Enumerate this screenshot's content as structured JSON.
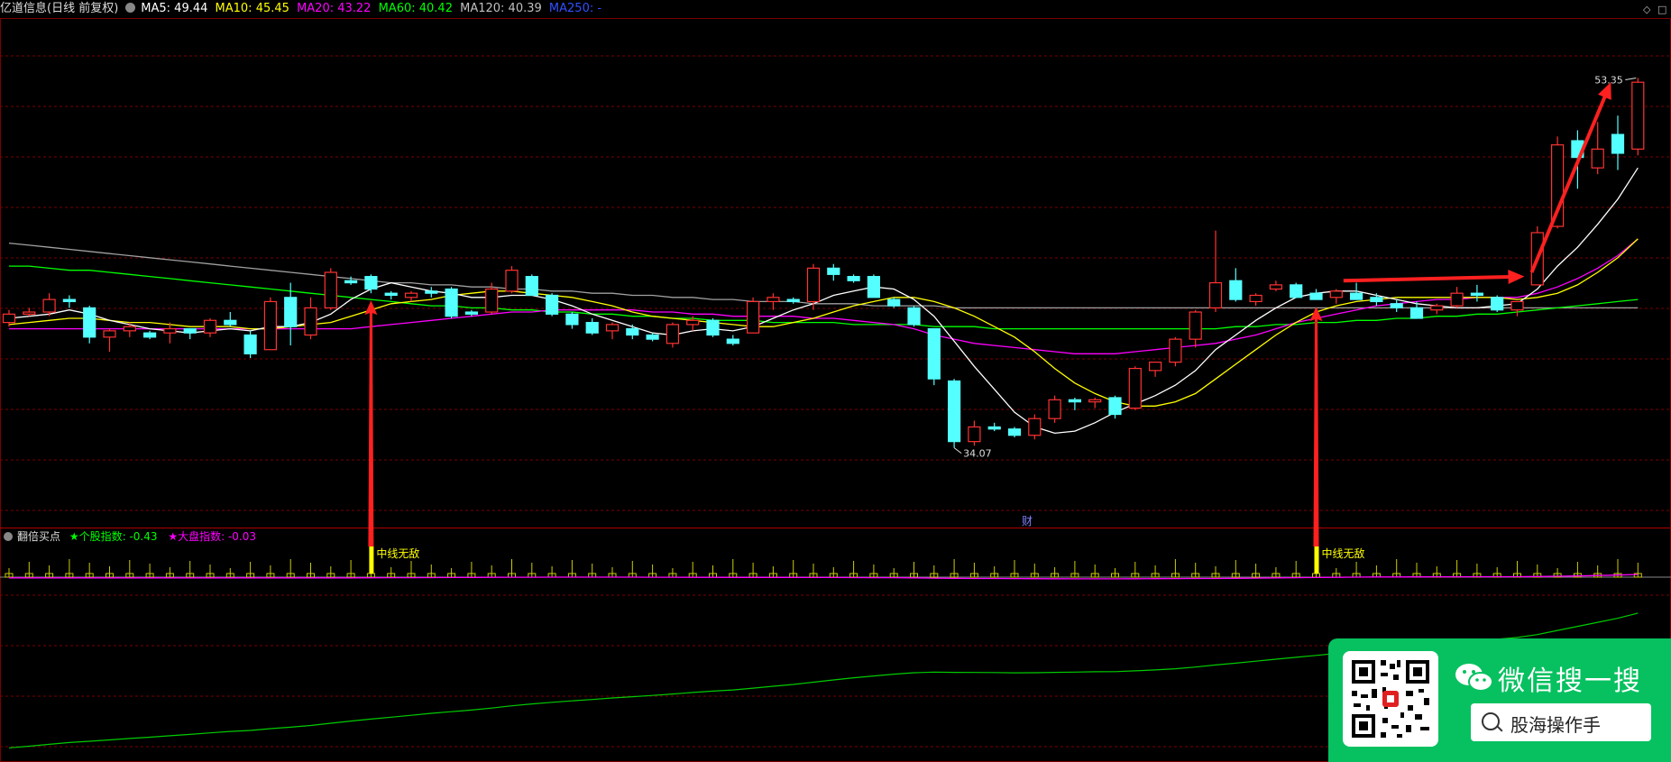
{
  "header": {
    "stock": "亿道信息(日线 前复权)",
    "ma5": "MA5: 49.44",
    "ma10": "MA10: 45.45",
    "ma20": "MA20: 43.22",
    "ma60": "MA60: 40.42",
    "ma120": "MA120: 40.39",
    "ma250": "MA250: -"
  },
  "indicator": {
    "name": "翻倍买点",
    "stock_index": "★个股指数: -0.43",
    "market_index": "★大盘指数: -0.03"
  },
  "annotations": {
    "high_label": "53.35",
    "low_label": "34.07",
    "cai": "财",
    "signal_label": "中线无敌"
  },
  "wechat": {
    "title": "微信搜一搜",
    "search_text": "股海操作手"
  },
  "colors": {
    "up": "#ff3232",
    "down": "#54ffff",
    "ma5": "#ffffff",
    "ma10": "#ffff00",
    "ma20": "#ff00ff",
    "ma60": "#00ff00",
    "ma120": "#a0a0a0",
    "arrow": "#ff2020",
    "signal": "#ffff00",
    "grid": "#7a0000"
  },
  "chart_data": {
    "type": "candlestick",
    "ylim": [
      32,
      56
    ],
    "candles": [
      [
        41.6,
        42.2,
        41.4,
        42.0
      ],
      [
        42.0,
        42.3,
        41.9,
        42.1
      ],
      [
        42.1,
        43.0,
        41.9,
        42.7
      ],
      [
        42.7,
        42.9,
        42.3,
        42.6
      ],
      [
        42.3,
        42.4,
        40.6,
        40.9
      ],
      [
        40.9,
        41.3,
        40.2,
        41.2
      ],
      [
        41.2,
        41.6,
        40.9,
        41.4
      ],
      [
        41.1,
        41.2,
        40.8,
        40.9
      ],
      [
        41.1,
        41.6,
        40.6,
        41.3
      ],
      [
        41.3,
        41.3,
        40.8,
        41.1
      ],
      [
        41.1,
        41.8,
        40.9,
        41.7
      ],
      [
        41.7,
        42.1,
        41.4,
        41.5
      ],
      [
        41.0,
        41.2,
        39.9,
        40.1
      ],
      [
        40.3,
        42.8,
        40.3,
        42.6
      ],
      [
        42.8,
        43.5,
        40.5,
        41.4
      ],
      [
        41.0,
        42.8,
        40.8,
        42.3
      ],
      [
        42.3,
        44.2,
        42.2,
        44.0
      ],
      [
        43.6,
        43.8,
        43.4,
        43.5
      ],
      [
        43.8,
        43.9,
        43.0,
        43.2
      ],
      [
        43.0,
        43.1,
        42.7,
        42.9
      ],
      [
        42.8,
        43.1,
        42.6,
        43.0
      ],
      [
        43.1,
        43.3,
        42.8,
        43.0
      ],
      [
        43.2,
        43.3,
        41.8,
        41.9
      ],
      [
        42.1,
        42.2,
        41.9,
        42.0
      ],
      [
        42.1,
        43.5,
        42.0,
        43.2
      ],
      [
        43.1,
        44.3,
        43.0,
        44.1
      ],
      [
        43.8,
        43.9,
        42.9,
        42.9
      ],
      [
        42.9,
        43.0,
        41.9,
        42.0
      ],
      [
        42.0,
        42.1,
        41.3,
        41.5
      ],
      [
        41.6,
        41.8,
        41.0,
        41.1
      ],
      [
        41.2,
        41.6,
        40.8,
        41.5
      ],
      [
        41.3,
        41.5,
        40.8,
        41.0
      ],
      [
        41.0,
        41.1,
        40.7,
        40.8
      ],
      [
        40.6,
        41.6,
        40.4,
        41.5
      ],
      [
        41.5,
        41.9,
        41.2,
        41.7
      ],
      [
        41.7,
        41.8,
        40.9,
        41.0
      ],
      [
        40.8,
        41.0,
        40.5,
        40.6
      ],
      [
        41.1,
        42.8,
        41.1,
        42.6
      ],
      [
        42.6,
        43.0,
        42.2,
        42.8
      ],
      [
        42.7,
        42.8,
        42.5,
        42.6
      ],
      [
        42.6,
        44.4,
        42.2,
        44.2
      ],
      [
        44.2,
        44.4,
        43.6,
        43.9
      ],
      [
        43.8,
        43.9,
        43.5,
        43.6
      ],
      [
        43.8,
        43.9,
        42.8,
        42.8
      ],
      [
        42.7,
        42.8,
        42.3,
        42.4
      ],
      [
        42.3,
        42.4,
        41.4,
        41.5
      ],
      [
        41.3,
        41.3,
        38.6,
        38.9
      ],
      [
        38.8,
        38.9,
        35.6,
        35.9
      ],
      [
        35.9,
        36.9,
        35.7,
        36.6
      ],
      [
        36.6,
        36.8,
        36.4,
        36.5
      ],
      [
        36.5,
        36.6,
        36.1,
        36.2
      ],
      [
        36.2,
        37.2,
        36.0,
        37.0
      ],
      [
        37.0,
        38.1,
        36.8,
        37.9
      ],
      [
        37.9,
        38.0,
        37.4,
        37.8
      ],
      [
        37.8,
        38.0,
        37.5,
        37.9
      ],
      [
        38.0,
        38.1,
        37.0,
        37.2
      ],
      [
        37.5,
        39.5,
        37.4,
        39.4
      ],
      [
        39.3,
        39.7,
        39.0,
        39.7
      ],
      [
        39.7,
        40.9,
        39.5,
        40.8
      ],
      [
        40.8,
        42.2,
        40.4,
        42.1
      ],
      [
        42.3,
        46.0,
        42.1,
        43.5
      ],
      [
        43.6,
        44.2,
        42.6,
        42.7
      ],
      [
        42.6,
        43.0,
        42.4,
        42.9
      ],
      [
        43.2,
        43.6,
        43.1,
        43.4
      ],
      [
        43.4,
        43.5,
        42.8,
        42.8
      ],
      [
        43.0,
        43.2,
        42.7,
        42.7
      ],
      [
        42.8,
        43.2,
        42.5,
        43.1
      ],
      [
        43.0,
        43.5,
        42.8,
        42.7
      ],
      [
        42.8,
        43.0,
        42.4,
        42.6
      ],
      [
        42.5,
        42.7,
        42.1,
        42.3
      ],
      [
        42.3,
        42.6,
        41.8,
        41.8
      ],
      [
        42.2,
        42.5,
        42.0,
        42.4
      ],
      [
        42.4,
        43.3,
        42.3,
        43.0
      ],
      [
        43.0,
        43.4,
        42.6,
        42.9
      ],
      [
        42.8,
        42.9,
        42.1,
        42.2
      ],
      [
        42.2,
        42.6,
        41.9,
        42.6
      ],
      [
        43.4,
        46.2,
        43.4,
        45.9
      ],
      [
        46.2,
        50.5,
        46.1,
        50.1
      ],
      [
        50.3,
        50.8,
        48.0,
        49.5
      ],
      [
        49.0,
        51.2,
        48.7,
        49.9
      ],
      [
        50.6,
        51.5,
        48.9,
        49.7
      ],
      [
        49.9,
        53.3,
        49.6,
        53.1
      ]
    ],
    "ma5": [
      41.8,
      41.9,
      42.0,
      42.2,
      42.0,
      41.7,
      41.5,
      41.3,
      41.2,
      41.1,
      41.2,
      41.3,
      41.2,
      41.4,
      41.4,
      41.6,
      42.0,
      42.7,
      43.2,
      43.5,
      43.3,
      43.1,
      43.0,
      42.8,
      42.8,
      42.9,
      42.9,
      42.7,
      42.4,
      42.0,
      41.7,
      41.4,
      41.1,
      41.0,
      41.2,
      41.3,
      41.2,
      41.4,
      41.8,
      42.2,
      42.5,
      42.9,
      43.1,
      43.3,
      43.2,
      42.7,
      41.9,
      40.7,
      39.5,
      38.4,
      37.3,
      36.6,
      36.3,
      36.4,
      36.8,
      37.3,
      37.7,
      38.1,
      38.6,
      39.3,
      40.3,
      41.0,
      41.7,
      42.3,
      42.8,
      43.0,
      43.1,
      43.1,
      42.9,
      42.7,
      42.5,
      42.4,
      42.3,
      42.3,
      42.4,
      42.5,
      43.2,
      44.3,
      45.2,
      46.3,
      47.5,
      49.0
    ],
    "ma10": [
      41.5,
      41.6,
      41.7,
      41.8,
      41.8,
      41.7,
      41.6,
      41.6,
      41.5,
      41.4,
      41.4,
      41.4,
      41.3,
      41.3,
      41.4,
      41.5,
      41.6,
      41.9,
      42.2,
      42.5,
      42.6,
      42.7,
      42.9,
      43.0,
      43.1,
      43.1,
      43.0,
      42.9,
      42.8,
      42.6,
      42.4,
      42.1,
      41.9,
      41.8,
      41.7,
      41.6,
      41.5,
      41.4,
      41.4,
      41.6,
      41.8,
      42.1,
      42.4,
      42.6,
      42.8,
      42.8,
      42.6,
      42.3,
      41.9,
      41.4,
      40.9,
      40.2,
      39.4,
      38.7,
      38.2,
      37.8,
      37.6,
      37.6,
      37.8,
      38.2,
      38.9,
      39.6,
      40.3,
      41.0,
      41.6,
      42.1,
      42.4,
      42.6,
      42.7,
      42.8,
      42.8,
      42.8,
      42.8,
      42.8,
      42.8,
      42.7,
      42.8,
      43.0,
      43.4,
      44.0,
      44.7,
      45.6
    ],
    "ma20": [
      41.3,
      41.3,
      41.3,
      41.3,
      41.3,
      41.3,
      41.3,
      41.3,
      41.3,
      41.3,
      41.3,
      41.3,
      41.3,
      41.3,
      41.3,
      41.3,
      41.3,
      41.3,
      41.4,
      41.5,
      41.6,
      41.7,
      41.8,
      41.9,
      42.0,
      42.1,
      42.1,
      42.2,
      42.2,
      42.2,
      42.2,
      42.2,
      42.1,
      42.1,
      42.0,
      42.0,
      41.9,
      41.9,
      41.9,
      41.9,
      41.8,
      41.8,
      41.7,
      41.6,
      41.5,
      41.3,
      41.0,
      40.8,
      40.6,
      40.5,
      40.4,
      40.3,
      40.2,
      40.1,
      40.1,
      40.1,
      40.2,
      40.3,
      40.4,
      40.5,
      40.6,
      40.8,
      41.0,
      41.3,
      41.6,
      41.8,
      42.0,
      42.2,
      42.4,
      42.5,
      42.6,
      42.7,
      42.7,
      42.8,
      42.8,
      42.8,
      43.0,
      43.3,
      43.7,
      44.2,
      44.8,
      45.6
    ],
    "ma60": [
      44.3,
      44.3,
      44.2,
      44.1,
      44.1,
      44.0,
      43.9,
      43.8,
      43.7,
      43.6,
      43.5,
      43.4,
      43.3,
      43.2,
      43.1,
      43.0,
      42.9,
      42.8,
      42.7,
      42.6,
      42.5,
      42.4,
      42.4,
      42.3,
      42.3,
      42.2,
      42.2,
      42.1,
      42.1,
      42.0,
      42.0,
      41.9,
      41.9,
      41.8,
      41.8,
      41.7,
      41.7,
      41.7,
      41.6,
      41.6,
      41.6,
      41.6,
      41.5,
      41.5,
      41.5,
      41.5,
      41.4,
      41.4,
      41.4,
      41.3,
      41.3,
      41.3,
      41.3,
      41.3,
      41.3,
      41.3,
      41.3,
      41.3,
      41.3,
      41.3,
      41.3,
      41.4,
      41.4,
      41.5,
      41.5,
      41.6,
      41.6,
      41.7,
      41.7,
      41.8,
      41.8,
      41.9,
      41.9,
      42.0,
      42.0,
      42.1,
      42.2,
      42.3,
      42.4,
      42.5,
      42.6,
      42.7
    ],
    "ma120": [
      45.4,
      45.3,
      45.2,
      45.1,
      45.0,
      44.9,
      44.8,
      44.7,
      44.6,
      44.5,
      44.4,
      44.3,
      44.2,
      44.1,
      44.0,
      43.9,
      43.8,
      43.7,
      43.6,
      43.5,
      43.5,
      43.4,
      43.4,
      43.3,
      43.3,
      43.2,
      43.2,
      43.1,
      43.1,
      43.0,
      43.0,
      42.9,
      42.9,
      42.8,
      42.8,
      42.7,
      42.7,
      42.6,
      42.6,
      42.6,
      42.5,
      42.5,
      42.5,
      42.4,
      42.4,
      42.4,
      42.4,
      42.3,
      42.3,
      42.3,
      42.3,
      42.3,
      42.3,
      42.3,
      42.3,
      42.3,
      42.3,
      42.3,
      42.3,
      42.3,
      42.3,
      42.3,
      42.3,
      42.3,
      42.3,
      42.3,
      42.3,
      42.3,
      42.3,
      42.3,
      42.3,
      42.3,
      42.3,
      42.3,
      42.3,
      42.3,
      42.3,
      42.3,
      42.3,
      42.3,
      42.3,
      42.3
    ],
    "signal_bars": [
      18,
      65
    ]
  }
}
